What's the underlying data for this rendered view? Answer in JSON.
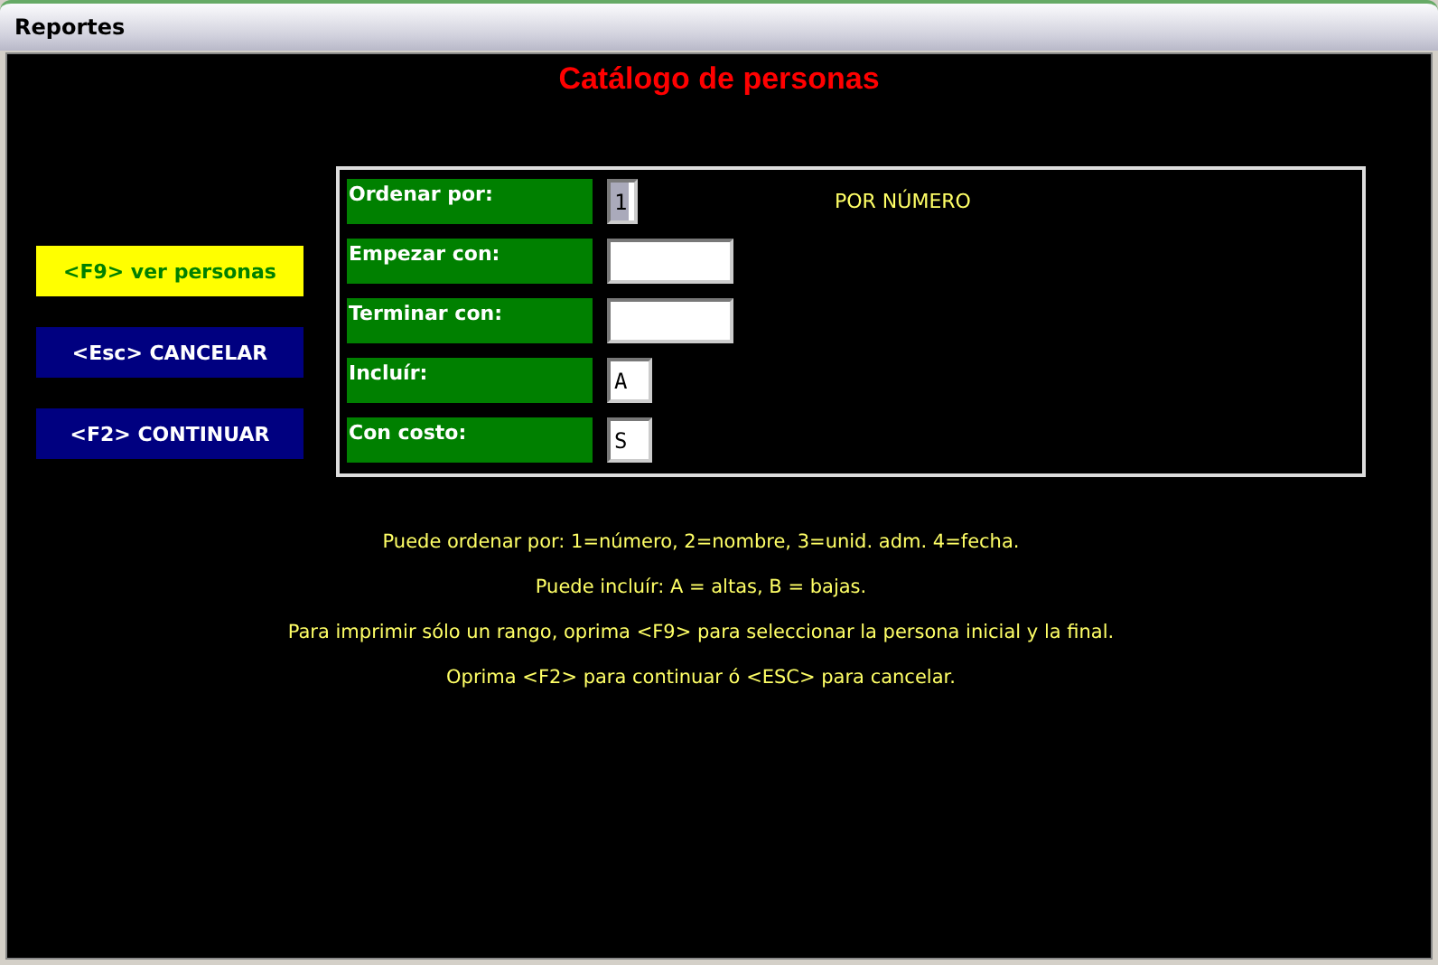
{
  "window": {
    "title": "Reportes"
  },
  "heading": "Catálogo de personas",
  "buttons": [
    {
      "label": "<F9> ver personas",
      "selected": true
    },
    {
      "label": "<Esc> CANCELAR",
      "selected": false
    },
    {
      "label": "<F2> CONTINUAR",
      "selected": false
    }
  ],
  "form": {
    "fields": [
      {
        "label": "Ordenar por:",
        "value": "1",
        "kind": "short",
        "selected": true
      },
      {
        "label": "Empezar con:",
        "kind": "long",
        "selected": false
      },
      {
        "label": "Terminar con:",
        "kind": "long",
        "selected": false
      },
      {
        "label": "Incluír:",
        "value": "A",
        "kind": "medium",
        "selected": false
      },
      {
        "label": "Con costo:",
        "value": "S",
        "kind": "medium",
        "selected": false
      }
    ],
    "hint": "POR NÚMERO"
  },
  "messages": [
    "Puede ordenar por: 1=número, 2=nombre, 3=unid. adm. 4=fecha.",
    "Puede incluír: A = altas, B = bajas.",
    "Para imprimir sólo un rango, oprima <F9> para seleccionar la persona inicial y la final.",
    "Oprima <F2> para continuar ó <ESC> para cancelar."
  ]
}
